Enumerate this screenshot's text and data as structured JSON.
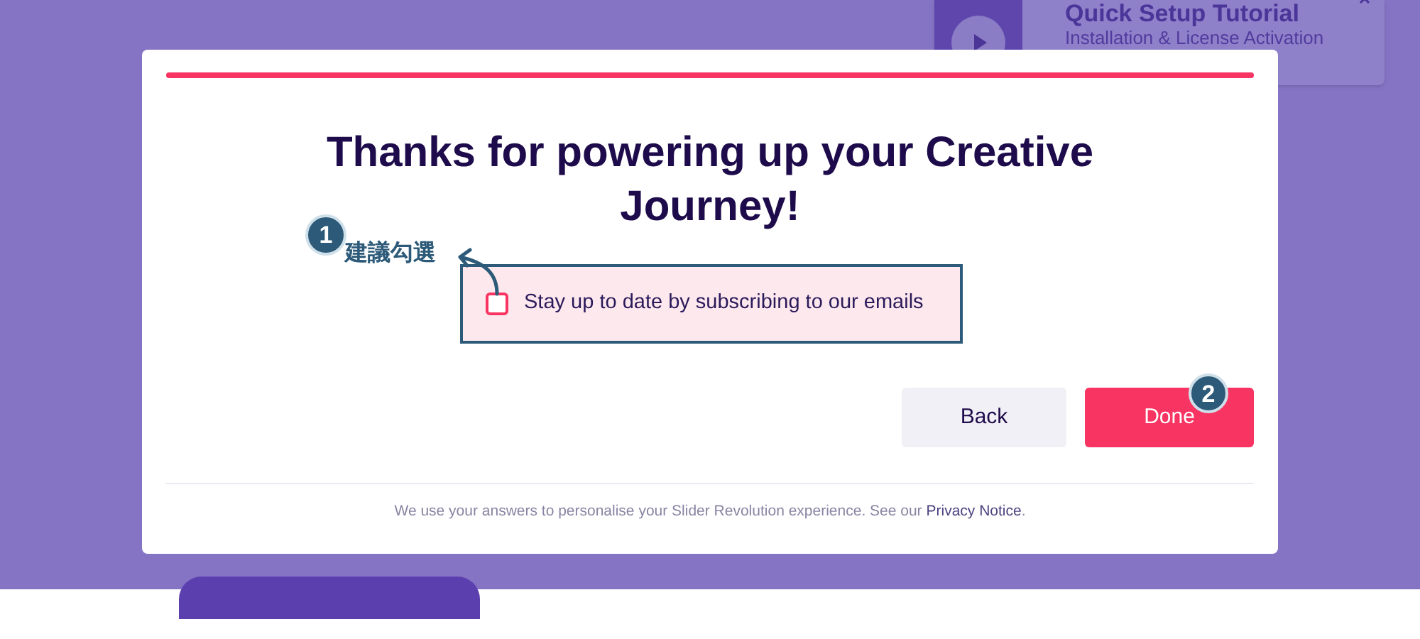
{
  "background": {
    "tutorial_card": {
      "title": "Quick Setup Tutorial",
      "subtitle": "Installation & License Activation"
    }
  },
  "dialog": {
    "progress": {
      "level": 1
    },
    "heading": "Thanks for powering up your Creative Journey!",
    "checkbox": {
      "label": "Stay up to date by subscribing to our emails",
      "checked": false
    },
    "buttons": [
      {
        "label": "Back",
        "kind": "secondary"
      },
      {
        "label": "Done",
        "kind": "primary"
      }
    ],
    "footer": {
      "text": "We use your answers to personalise your Slider Revolution experience. See our",
      "link": "Privacy Notice",
      "suffix": "."
    }
  },
  "annotations": [
    {
      "number": "1",
      "note": "建議勾選"
    },
    {
      "number": "2"
    }
  ]
}
